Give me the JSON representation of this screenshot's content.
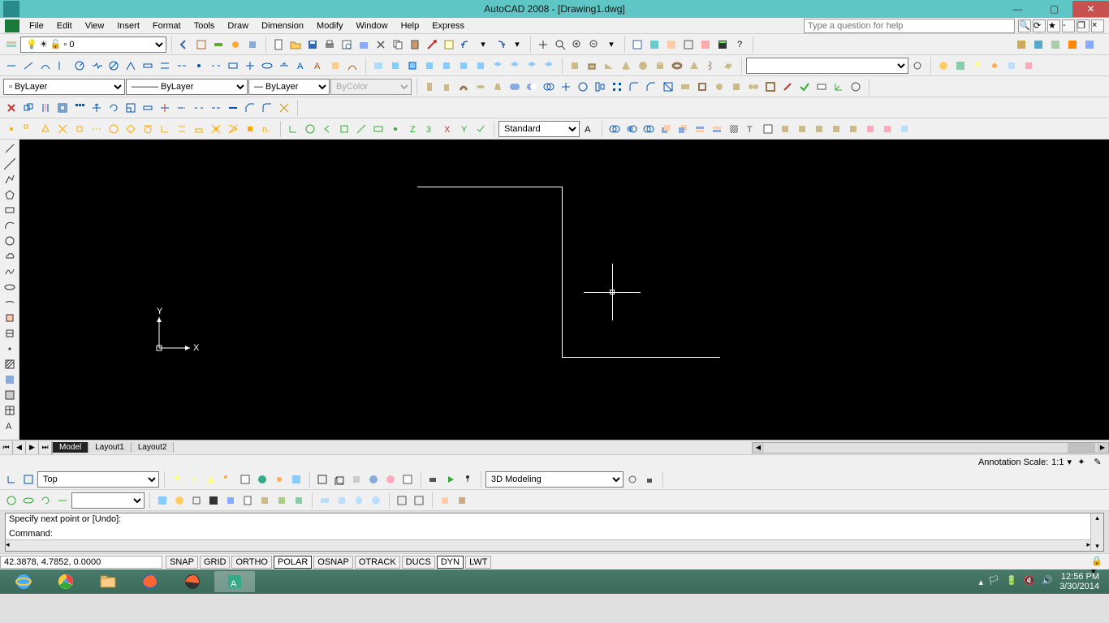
{
  "title": "AutoCAD 2008 - [Drawing1.dwg]",
  "help_placeholder": "Type a question for help",
  "menus": [
    "File",
    "Edit",
    "View",
    "Insert",
    "Format",
    "Tools",
    "Draw",
    "Dimension",
    "Modify",
    "Window",
    "Help",
    "Express"
  ],
  "layer": {
    "current": "0"
  },
  "linetype": "ByLayer",
  "lineweight": "ByLayer",
  "plotstyle_label": "ByLayer",
  "color_label": "ByColor",
  "textstyle": "Standard",
  "view_dd": "Top",
  "workspace": "3D Modeling",
  "layout": {
    "tabs": [
      "Model",
      "Layout1",
      "Layout2"
    ],
    "active": 0
  },
  "annotation": {
    "label": "Annotation Scale:",
    "value": "1:1"
  },
  "command_output": "Specify next point or [Undo]:",
  "command_prompt": "Command:",
  "status": {
    "coords": "42.3878, 4.7852, 0.0000",
    "buttons": [
      "SNAP",
      "GRID",
      "ORTHO",
      "POLAR",
      "OSNAP",
      "OTRACK",
      "DUCS",
      "DYN",
      "LWT"
    ],
    "active": {
      "POLAR": true,
      "DYN": true
    }
  },
  "systray": {
    "time": "12:56 PM",
    "date": "3/30/2014"
  }
}
